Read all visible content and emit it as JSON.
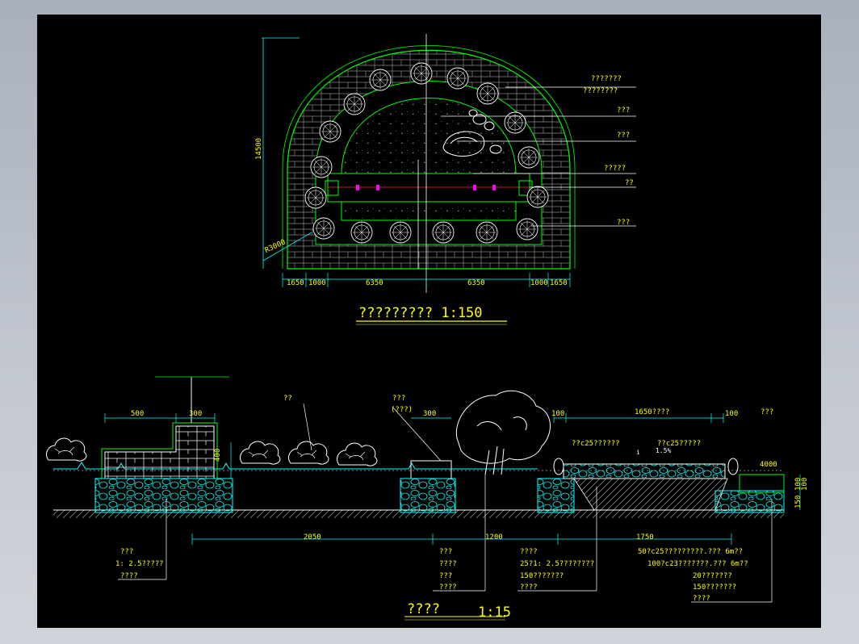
{
  "drawing": {
    "plan_title": "????????? 1:150",
    "section_title": "????",
    "section_scale": "1:15"
  },
  "plan": {
    "dim_height": "14500",
    "dim_radius": "R3000",
    "dims_bottom": [
      "1650",
      "1000",
      "6350",
      "6350",
      "1000",
      "1650"
    ],
    "callouts": [
      "???????",
      "????????",
      "???",
      "???",
      "?????",
      "??",
      "???"
    ]
  },
  "section": {
    "top_dims": [
      "500",
      "300",
      "300",
      "100",
      "1650????",
      "100"
    ],
    "side_dims": [
      "400",
      "4000",
      "100",
      "100",
      "150"
    ],
    "slope_labels": [
      "i",
      "1.5%"
    ],
    "labels_top": [
      "??",
      "???",
      "(???)",
      "??c25??????",
      "??c25?????",
      "???"
    ],
    "bottom_dims": [
      "2050",
      "1200",
      "1750"
    ],
    "callouts_left": [
      "???",
      "1: 2.5?????",
      "????"
    ],
    "callouts_mid": [
      "???",
      "????",
      "???",
      "????"
    ],
    "callouts_mid2": [
      "????",
      "25?1: 2.5????????",
      "150???????",
      "????"
    ],
    "callouts_right": [
      "50?c25?????????.???  6m??",
      "100?c23???????.???  6m??",
      "20???????",
      "150???????",
      "????"
    ]
  },
  "colors": {
    "background": "#000000",
    "frame": "#b0b7c3",
    "dimension": "#00ffff",
    "green": "#00ff00",
    "text": "#ffff00",
    "magenta": "#ff00ff",
    "white": "#ffffff"
  }
}
